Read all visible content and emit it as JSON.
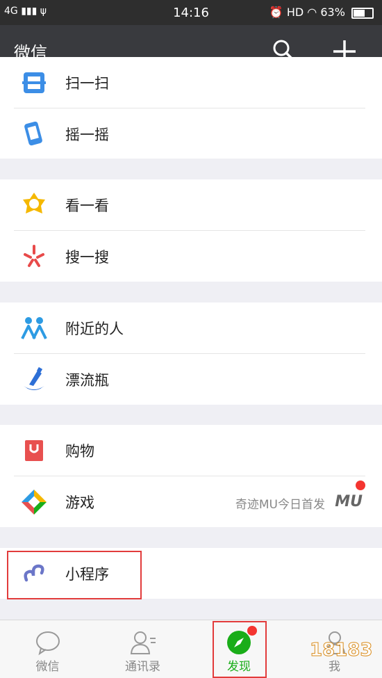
{
  "status": {
    "network": "4G",
    "time": "14:16",
    "hd": "HD",
    "battery": "63%"
  },
  "header": {
    "title": "微信"
  },
  "groups": [
    {
      "items": [
        {
          "label": "扫一扫"
        },
        {
          "label": "摇一摇"
        }
      ]
    },
    {
      "items": [
        {
          "label": "看一看"
        },
        {
          "label": "搜一搜"
        }
      ]
    },
    {
      "items": [
        {
          "label": "附近的人"
        },
        {
          "label": "漂流瓶"
        }
      ]
    },
    {
      "items": [
        {
          "label": "购物"
        },
        {
          "label": "游戏",
          "detail": "奇迹MU今日首发",
          "badge_logo": "MU"
        }
      ]
    },
    {
      "items": [
        {
          "label": "小程序"
        }
      ]
    }
  ],
  "tabs": [
    {
      "label": "微信"
    },
    {
      "label": "通讯录"
    },
    {
      "label": "发现",
      "active": true
    },
    {
      "label": "我"
    }
  ],
  "watermark": "18183",
  "colors": {
    "accent": "#1aad19",
    "badge": "#f43530",
    "highlight": "#e23b3b",
    "header_bg": "#393a3e"
  }
}
